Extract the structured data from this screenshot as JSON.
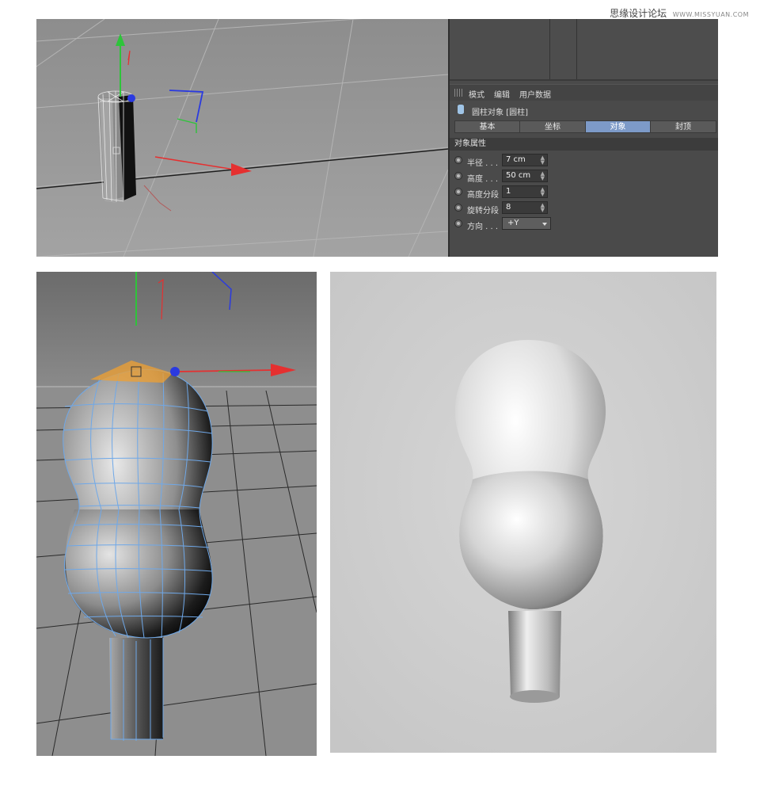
{
  "watermark": {
    "site_cn": "思缘设计论坛",
    "site_url": "WWW.MISSYUAN.COM"
  },
  "attribute_panel": {
    "menu": [
      "模式",
      "编辑",
      "用户数据"
    ],
    "object_title": "圆柱对象 [圆柱]",
    "tabs": [
      {
        "label": "基本",
        "active": false
      },
      {
        "label": "坐标",
        "active": false
      },
      {
        "label": "对象",
        "active": true
      },
      {
        "label": "封顶",
        "active": false
      }
    ],
    "section_title": "对象属性",
    "properties": [
      {
        "label": "半径 . . .",
        "value": "7 cm",
        "type": "spinner"
      },
      {
        "label": "高度 . . .",
        "value": "50 cm",
        "type": "spinner"
      },
      {
        "label": "高度分段",
        "value": "1",
        "type": "spinner"
      },
      {
        "label": "旋转分段",
        "value": "8",
        "type": "spinner"
      },
      {
        "label": "方向 . . .",
        "value": "+Y",
        "type": "dropdown"
      }
    ]
  },
  "colors": {
    "panel_bg": "#4a4a4a",
    "tab_active": "#7d9ac8",
    "viewport_bg": "#9a9a9a",
    "wireframe": "#6fa8e8",
    "axis_x": "#e53030",
    "axis_y": "#2ec43a",
    "axis_z": "#2a3ae0",
    "selection": "#f0a030"
  },
  "icons": [
    "cylinder-object-icon",
    "grip-icon",
    "radio-icon",
    "spinner-icon",
    "dropdown-caret-icon"
  ]
}
